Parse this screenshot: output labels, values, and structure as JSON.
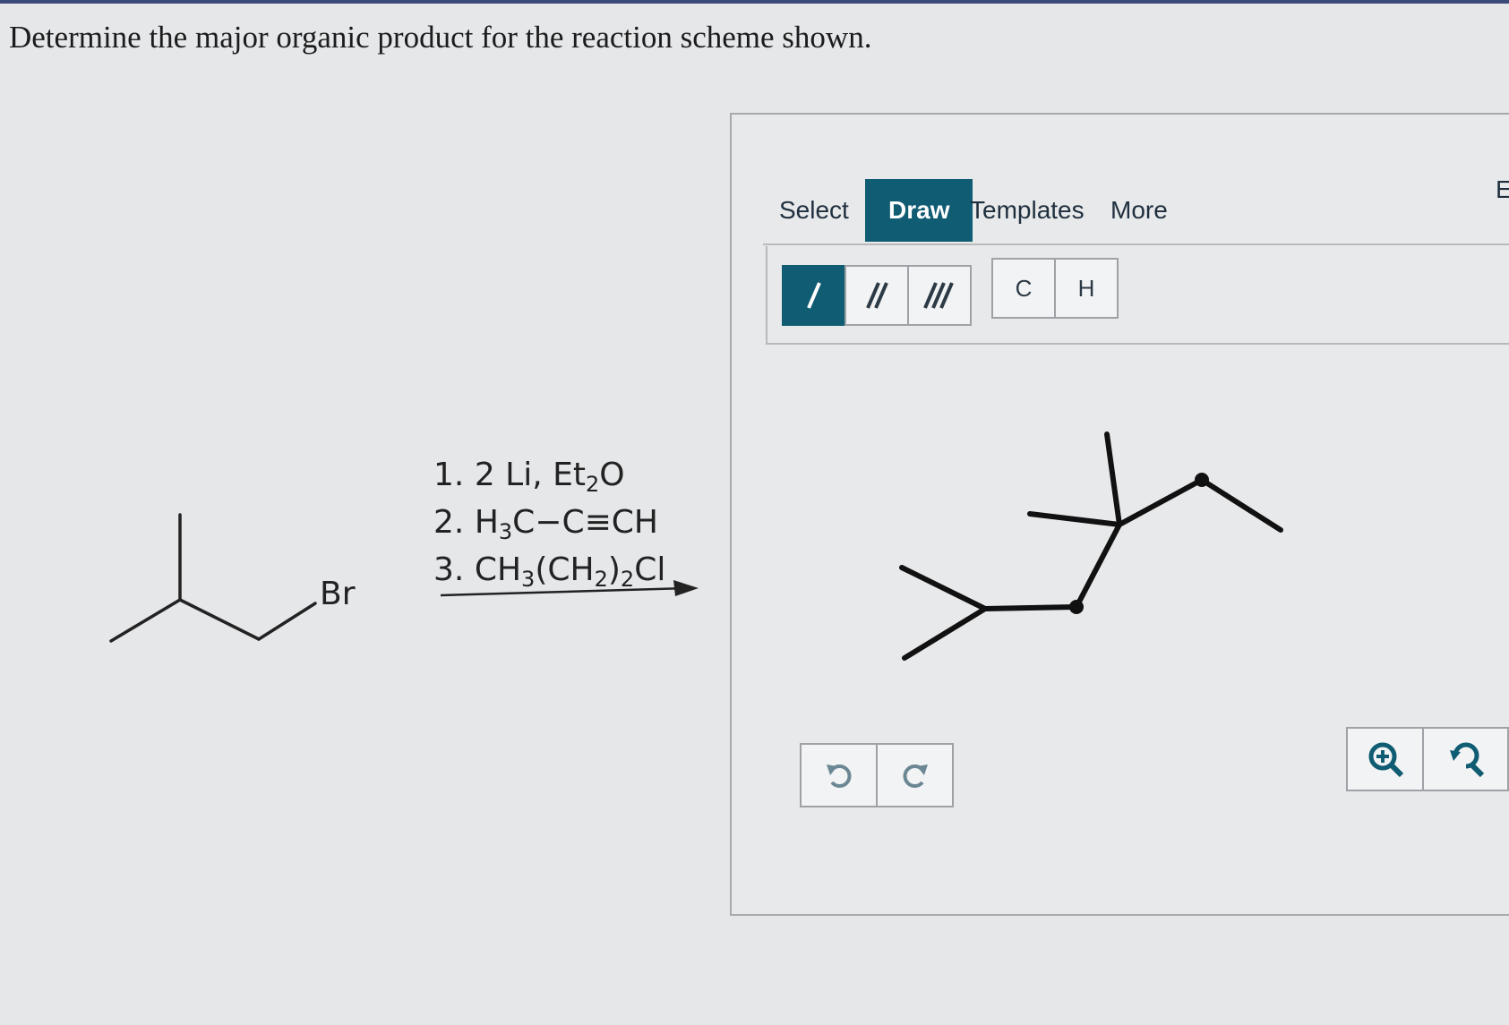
{
  "question": {
    "text": "Determine the major organic product for the reaction scheme shown."
  },
  "scheme": {
    "leaving_group_label": "Br",
    "steps": [
      {
        "number": "1.",
        "text": "2 Li, Et",
        "sub": "2",
        "after": "O"
      },
      {
        "number": "2.",
        "text": "H",
        "sub": "3",
        "after": "C−C≡CH"
      },
      {
        "number": "3.",
        "text": "CH",
        "sub": "3",
        "after": "(CH",
        "sub2": "2",
        "after2": ")",
        "sub3": "2",
        "after3": "Cl"
      }
    ]
  },
  "editor": {
    "tabs": {
      "select": "Select",
      "draw": "Draw",
      "templates": "Templates",
      "more": "More",
      "right_edge": "E"
    },
    "bond_tools": {
      "single": "/",
      "double": "//",
      "triple": "///"
    },
    "atoms": {
      "carbon": "C",
      "hydrogen": "H"
    },
    "active_tab": "Draw",
    "active_bond_tool": "single",
    "colors": {
      "accent": "#0f5c73",
      "structure": "#111111",
      "button_border": "#9ea2a6"
    }
  }
}
